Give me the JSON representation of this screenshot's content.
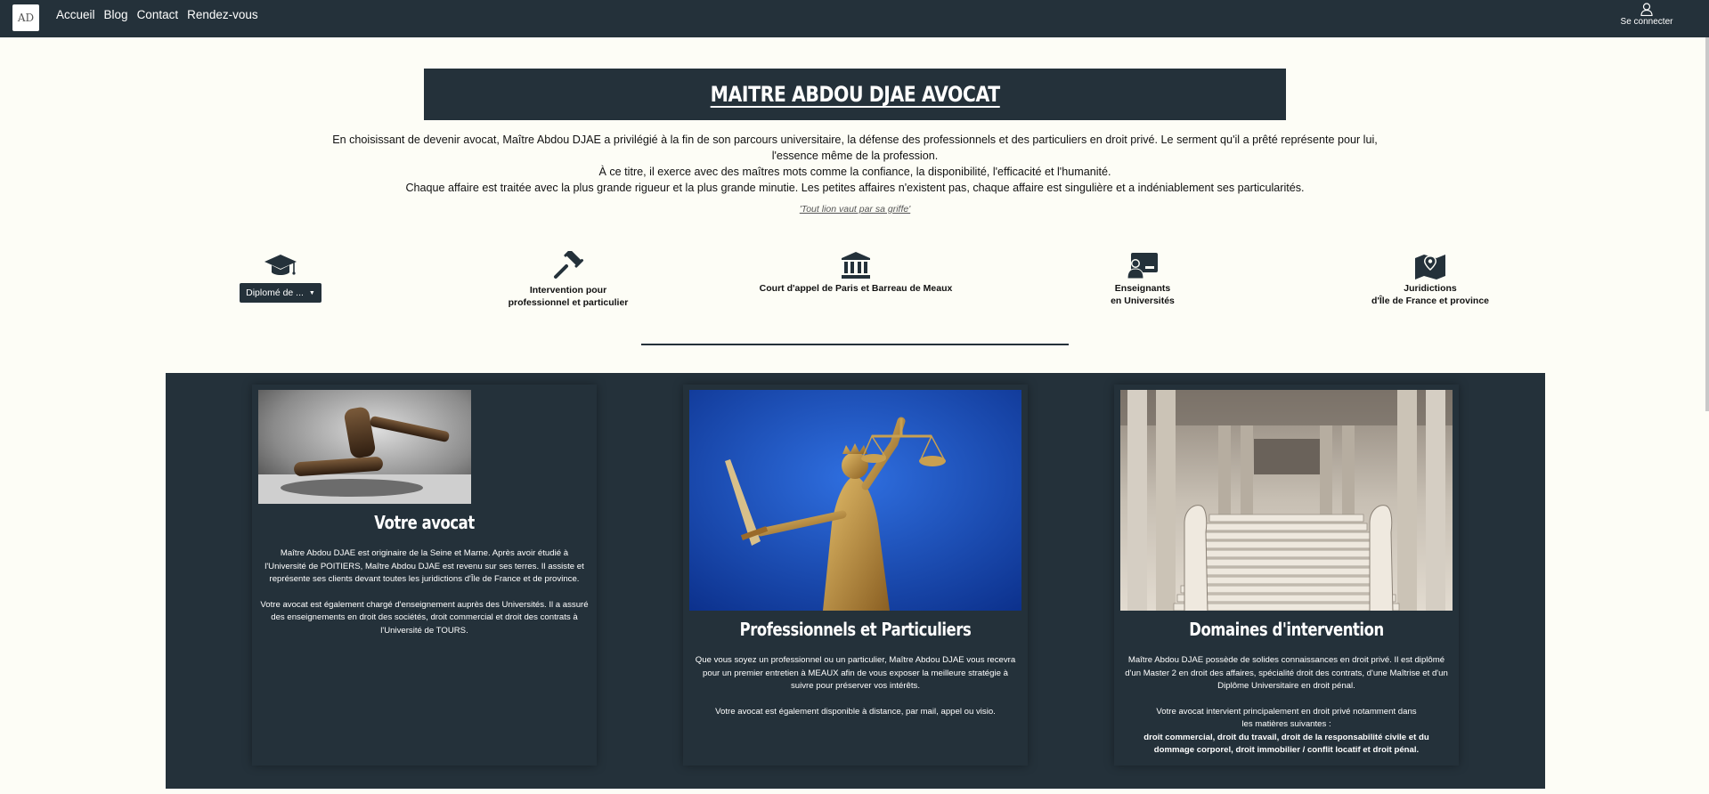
{
  "nav": {
    "logo_text": "AD",
    "links": [
      "Accueil",
      "Blog",
      "Contact",
      "Rendez-vous"
    ],
    "login_label": "Se connecter"
  },
  "header": {
    "title": "MAITRE ABDOU DJAE AVOCAT",
    "intro_lines": [
      "En choisissant de devenir avocat, Maître Abdou DJAE a privilégié à la fin de son parcours universitaire, la défense des professionnels et des particuliers en droit privé. Le serment qu'il a prêté représente pour lui,",
      "l'essence même de la profession.",
      "À ce titre, il exerce avec des maîtres mots comme la confiance, la disponibilité, l'efficacité et l'humanité.",
      "Chaque affaire est traitée avec la plus grande rigueur et la plus grande minutie. Les petites affaires n'existent pas, chaque affaire est singulière et a indéniablement ses particularités."
    ],
    "quote": "'Tout lion vaut par sa griffe'"
  },
  "features": [
    {
      "icon": "graduation-cap-icon",
      "dropdown_label": "Diplomé de ..."
    },
    {
      "icon": "gavel-icon",
      "lines": [
        "Intervention pour",
        "professionnel et particulier"
      ]
    },
    {
      "icon": "courthouse-icon",
      "lines": [
        "Court d'appel de Paris et Barreau de Meaux"
      ]
    },
    {
      "icon": "teacher-board-icon",
      "lines": [
        "Enseignants",
        "en Universités"
      ]
    },
    {
      "icon": "map-pin-icon",
      "lines": [
        "Juridictions",
        "d'Île de France et province"
      ]
    }
  ],
  "cards": [
    {
      "title": "Votre avocat",
      "image": "gavel-photo",
      "paragraphs": [
        "Maître Abdou DJAE est originaire de la Seine et Marne. Après avoir étudié à l'Université de POITIERS, Maître Abdou DJAE est revenu sur ses terres. Il assiste et représente ses clients devant toutes les juridictions d'Île de France et de province.",
        "Votre avocat est également chargé d'enseignement auprès des Universités. Il a assuré des enseignements en droit des sociétés, droit commercial et droit des contrats à l'Université de TOURS."
      ]
    },
    {
      "title": "Professionnels et Particuliers",
      "image": "lady-justice-photo",
      "paragraphs": [
        "Que vous soyez un professionnel ou un particulier, Maître Abdou DJAE vous recevra pour un premier entretien à MEAUX afin de vous exposer la meilleure stratégie à suivre pour préserver vos intérêts.",
        "Votre avocat est également disponible à distance, par mail, appel ou visio."
      ]
    },
    {
      "title": "Domaines d'intervention",
      "image": "courthouse-stairs-photo",
      "paragraphs": [
        "Maître Abdou DJAE possède de solides connaissances en droit privé. Il est diplômé d'un Master 2 en droit des affaires, spécialité droit des contrats, d'une Maîtrise et d'un Diplôme Universitaire en droit pénal."
      ],
      "intro_line1": "Votre avocat intervient principalement en droit privé notamment dans",
      "intro_line2": "les matières suivantes :",
      "bold": "droit commercial, droit du travail, droit de la responsabilité civile et du dommage corporel, droit immobilier / conflit locatif et droit pénal."
    }
  ],
  "colors": {
    "primary": "#24313a",
    "background": "#fdfdf6",
    "text_light": "#ffffff"
  }
}
